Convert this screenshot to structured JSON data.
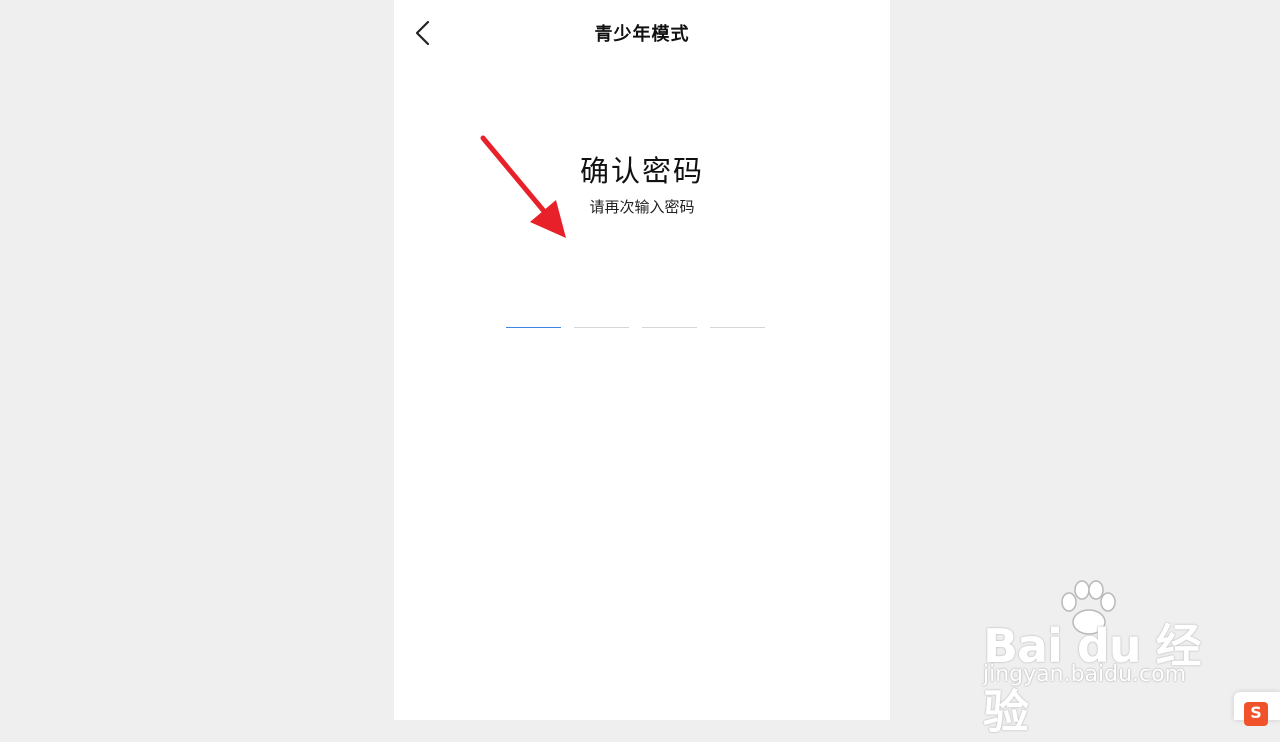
{
  "nav": {
    "title": "青少年模式",
    "back_icon": "chevron-left-icon"
  },
  "confirm": {
    "heading": "确认密码",
    "subheading": "请再次输入密码"
  },
  "pin": {
    "length": 4,
    "cells": [
      "",
      "",
      "",
      ""
    ],
    "active_index": 0
  },
  "annotation": {
    "icon": "red-arrow-icon",
    "color": "#e8202a"
  },
  "watermark": {
    "brand": "Bai du 经验",
    "url": "jingyan.baidu.com"
  },
  "colors": {
    "accent": "#3d86e6",
    "background": "#efefef",
    "screen": "#ffffff"
  }
}
